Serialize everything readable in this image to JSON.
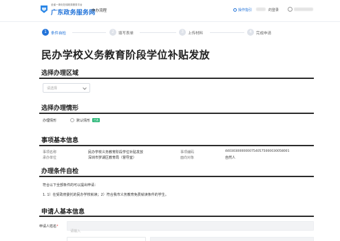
{
  "header": {
    "brand_small": "全省一体化在线政务服务平台",
    "brand_big": "广东政务服务网",
    "tab": "申办流程",
    "guide": "操作指引",
    "login": "的登录"
  },
  "steps": [
    {
      "num": "1",
      "label": "条件自检"
    },
    {
      "num": "2",
      "label": "填写表单"
    },
    {
      "num": "3",
      "label": "上传材料"
    },
    {
      "num": "4",
      "label": "完成申请"
    }
  ],
  "page_title": "民办学校义务教育阶段学位补贴发放",
  "region": {
    "title": "选择办理区域",
    "placeholder": "请选择"
  },
  "situation": {
    "title": "选择办理情形",
    "label": "办理情形",
    "option": "默认情形",
    "badge": "已选"
  },
  "basic_info": {
    "title": "事项基本信息",
    "name_label": "事项名称",
    "name_value": "民办学校义务教育阶段学位补贴发放",
    "unit_label": "承办单位",
    "unit_value": "深圳市罗湖区教育局（督导室）",
    "code_label": "事项编码",
    "code_value": "44030300000007540575000030058001",
    "target_label": "面向对象",
    "target_value": "自然人"
  },
  "conditions": {
    "title": "办理条件自检",
    "intro": "符合以下全部条件的可以提出申请：",
    "item": "1. 1）在受政府委托的民办学校就读；2）符合我市义务教育免费就读条件的学生。"
  },
  "applicant": {
    "title": "申请人基本信息",
    "name_label": "申请人姓名",
    "required_mark": "*",
    "name_placeholder": "请输入"
  }
}
